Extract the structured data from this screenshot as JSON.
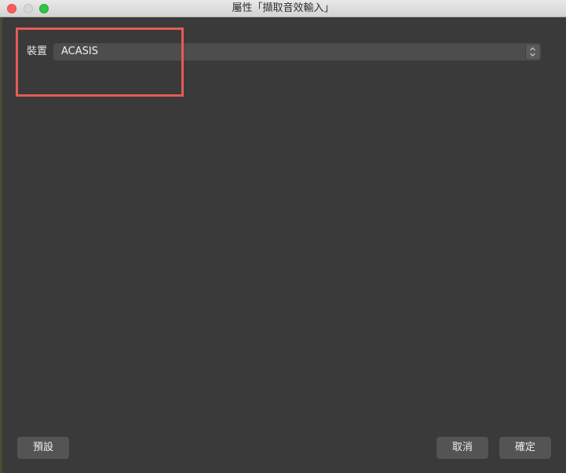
{
  "window": {
    "title": "屬性「擷取音效輸入」"
  },
  "form": {
    "device_label": "裝置",
    "device_value": "ACASIS"
  },
  "buttons": {
    "defaults": "預設",
    "cancel": "取消",
    "ok": "確定"
  },
  "colors": {
    "highlight": "#e45c55",
    "background": "#3a3a3a"
  }
}
